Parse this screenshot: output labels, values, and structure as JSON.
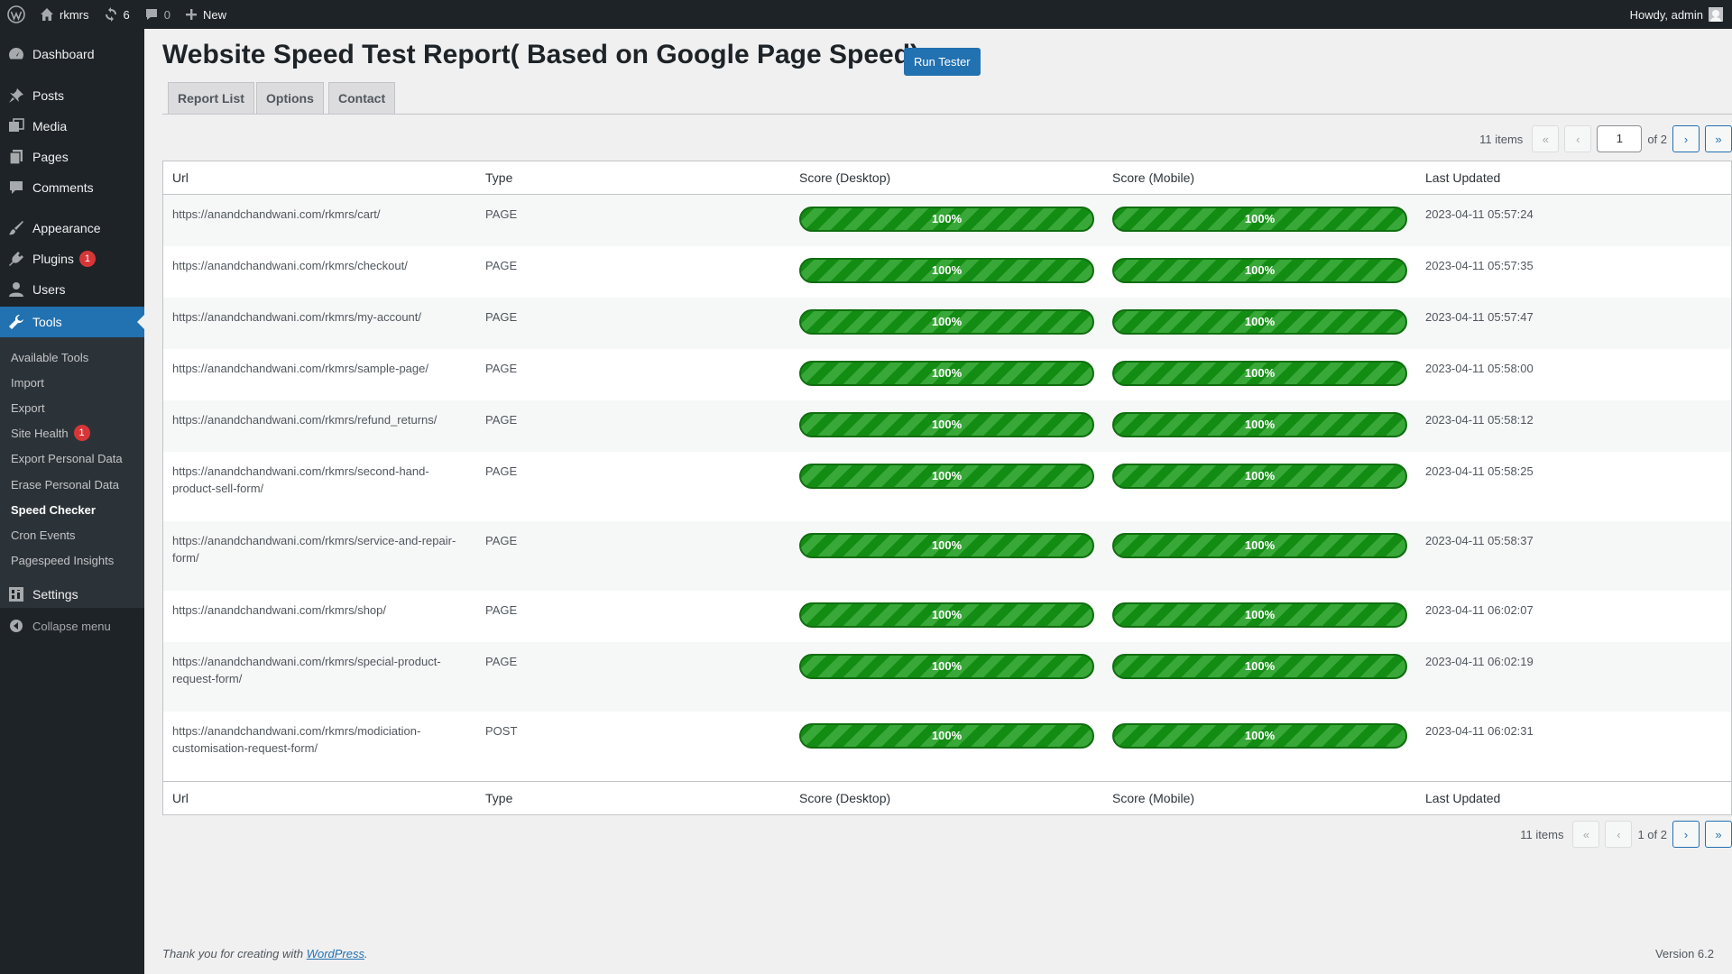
{
  "adminbar": {
    "site_name": "rkmrs",
    "updates_count": "6",
    "comments_count": "0",
    "new_label": "New",
    "howdy": "Howdy, admin"
  },
  "sidebar": {
    "items": [
      {
        "label": "Dashboard",
        "icon": "dashboard-icon"
      },
      {
        "label": "Posts",
        "icon": "pin-icon"
      },
      {
        "label": "Media",
        "icon": "media-icon"
      },
      {
        "label": "Pages",
        "icon": "pages-icon"
      },
      {
        "label": "Comments",
        "icon": "comment-icon"
      },
      {
        "label": "Appearance",
        "icon": "brush-icon"
      },
      {
        "label": "Plugins",
        "icon": "plug-icon",
        "badge": "1"
      },
      {
        "label": "Users",
        "icon": "user-icon"
      },
      {
        "label": "Tools",
        "icon": "wrench-icon"
      },
      {
        "label": "Settings",
        "icon": "settings-icon"
      }
    ],
    "submenu": [
      "Available Tools",
      "Import",
      "Export",
      "Site Health",
      "Export Personal Data",
      "Erase Personal Data",
      "Speed Checker",
      "Cron Events",
      "Pagespeed Insights"
    ],
    "site_health_badge": "1",
    "collapse_label": "Collapse menu"
  },
  "page": {
    "title": "Website Speed Test Report( Based on Google Page Speed)",
    "run_button": "Run Tester",
    "tabs": [
      "Report List",
      "Options",
      "Contact"
    ]
  },
  "pagination_top": {
    "items": "11 items",
    "first": "«",
    "prev": "‹",
    "current_page": "1",
    "of_total": "of 2",
    "next": "›",
    "last": "»"
  },
  "pagination_bottom": {
    "items": "11 items",
    "first": "«",
    "prev": "‹",
    "page_text": "1 of 2",
    "next": "›",
    "last": "»"
  },
  "table": {
    "columns": [
      "Url",
      "Type",
      "Score (Desktop)",
      "Score (Mobile)",
      "Last Updated"
    ],
    "rows": [
      {
        "url": "https://anandchandwani.com/rkmrs/cart/",
        "type": "PAGE",
        "desktop": "100%",
        "mobile": "100%",
        "updated": "2023-04-11 05:57:24"
      },
      {
        "url": "https://anandchandwani.com/rkmrs/checkout/",
        "type": "PAGE",
        "desktop": "100%",
        "mobile": "100%",
        "updated": "2023-04-11 05:57:35"
      },
      {
        "url": "https://anandchandwani.com/rkmrs/my-account/",
        "type": "PAGE",
        "desktop": "100%",
        "mobile": "100%",
        "updated": "2023-04-11 05:57:47"
      },
      {
        "url": "https://anandchandwani.com/rkmrs/sample-page/",
        "type": "PAGE",
        "desktop": "100%",
        "mobile": "100%",
        "updated": "2023-04-11 05:58:00"
      },
      {
        "url": "https://anandchandwani.com/rkmrs/refund_returns/",
        "type": "PAGE",
        "desktop": "100%",
        "mobile": "100%",
        "updated": "2023-04-11 05:58:12"
      },
      {
        "url": "https://anandchandwani.com/rkmrs/second-hand-product-sell-form/",
        "type": "PAGE",
        "desktop": "100%",
        "mobile": "100%",
        "updated": "2023-04-11 05:58:25"
      },
      {
        "url": "https://anandchandwani.com/rkmrs/service-and-repair-form/",
        "type": "PAGE",
        "desktop": "100%",
        "mobile": "100%",
        "updated": "2023-04-11 05:58:37"
      },
      {
        "url": "https://anandchandwani.com/rkmrs/shop/",
        "type": "PAGE",
        "desktop": "100%",
        "mobile": "100%",
        "updated": "2023-04-11 06:02:07"
      },
      {
        "url": "https://anandchandwani.com/rkmrs/special-product-request-form/",
        "type": "PAGE",
        "desktop": "100%",
        "mobile": "100%",
        "updated": "2023-04-11 06:02:19"
      },
      {
        "url": "https://anandchandwani.com/rkmrs/modiciation-customisation-request-form/",
        "type": "POST",
        "desktop": "100%",
        "mobile": "100%",
        "updated": "2023-04-11 06:02:31"
      }
    ]
  },
  "footer": {
    "thanks_prefix": "Thank you for creating with",
    "link": "WordPress",
    "suffix": ".",
    "version": "Version 6.2"
  },
  "colors": {
    "accent": "#2271b1",
    "sidebar_bg": "#1d2327",
    "bar_green": "#138c13",
    "badge_red": "#d63638"
  }
}
